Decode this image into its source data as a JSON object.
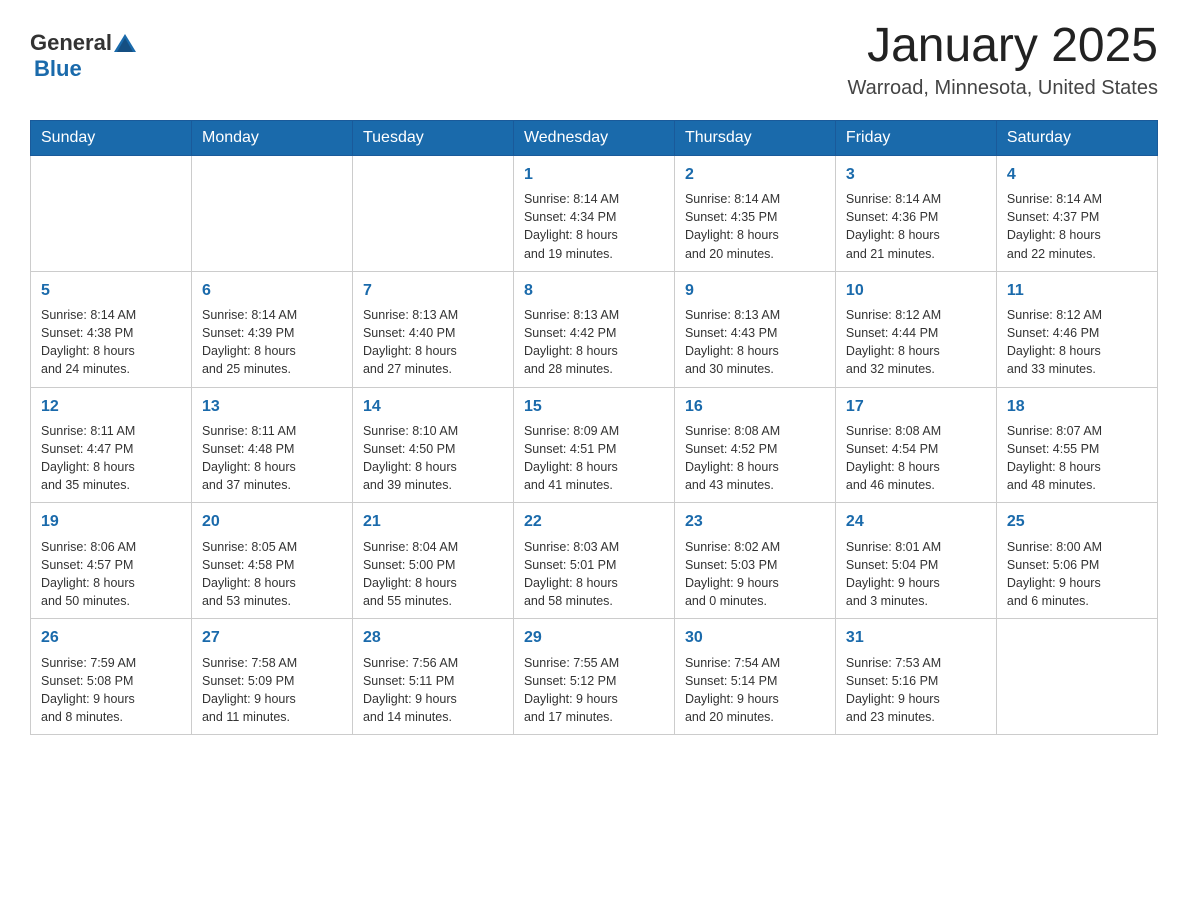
{
  "header": {
    "logo_general": "General",
    "logo_blue": "Blue",
    "month_title": "January 2025",
    "location": "Warroad, Minnesota, United States"
  },
  "days_of_week": [
    "Sunday",
    "Monday",
    "Tuesday",
    "Wednesday",
    "Thursday",
    "Friday",
    "Saturday"
  ],
  "weeks": [
    [
      {
        "day": "",
        "info": ""
      },
      {
        "day": "",
        "info": ""
      },
      {
        "day": "",
        "info": ""
      },
      {
        "day": "1",
        "info": "Sunrise: 8:14 AM\nSunset: 4:34 PM\nDaylight: 8 hours\nand 19 minutes."
      },
      {
        "day": "2",
        "info": "Sunrise: 8:14 AM\nSunset: 4:35 PM\nDaylight: 8 hours\nand 20 minutes."
      },
      {
        "day": "3",
        "info": "Sunrise: 8:14 AM\nSunset: 4:36 PM\nDaylight: 8 hours\nand 21 minutes."
      },
      {
        "day": "4",
        "info": "Sunrise: 8:14 AM\nSunset: 4:37 PM\nDaylight: 8 hours\nand 22 minutes."
      }
    ],
    [
      {
        "day": "5",
        "info": "Sunrise: 8:14 AM\nSunset: 4:38 PM\nDaylight: 8 hours\nand 24 minutes."
      },
      {
        "day": "6",
        "info": "Sunrise: 8:14 AM\nSunset: 4:39 PM\nDaylight: 8 hours\nand 25 minutes."
      },
      {
        "day": "7",
        "info": "Sunrise: 8:13 AM\nSunset: 4:40 PM\nDaylight: 8 hours\nand 27 minutes."
      },
      {
        "day": "8",
        "info": "Sunrise: 8:13 AM\nSunset: 4:42 PM\nDaylight: 8 hours\nand 28 minutes."
      },
      {
        "day": "9",
        "info": "Sunrise: 8:13 AM\nSunset: 4:43 PM\nDaylight: 8 hours\nand 30 minutes."
      },
      {
        "day": "10",
        "info": "Sunrise: 8:12 AM\nSunset: 4:44 PM\nDaylight: 8 hours\nand 32 minutes."
      },
      {
        "day": "11",
        "info": "Sunrise: 8:12 AM\nSunset: 4:46 PM\nDaylight: 8 hours\nand 33 minutes."
      }
    ],
    [
      {
        "day": "12",
        "info": "Sunrise: 8:11 AM\nSunset: 4:47 PM\nDaylight: 8 hours\nand 35 minutes."
      },
      {
        "day": "13",
        "info": "Sunrise: 8:11 AM\nSunset: 4:48 PM\nDaylight: 8 hours\nand 37 minutes."
      },
      {
        "day": "14",
        "info": "Sunrise: 8:10 AM\nSunset: 4:50 PM\nDaylight: 8 hours\nand 39 minutes."
      },
      {
        "day": "15",
        "info": "Sunrise: 8:09 AM\nSunset: 4:51 PM\nDaylight: 8 hours\nand 41 minutes."
      },
      {
        "day": "16",
        "info": "Sunrise: 8:08 AM\nSunset: 4:52 PM\nDaylight: 8 hours\nand 43 minutes."
      },
      {
        "day": "17",
        "info": "Sunrise: 8:08 AM\nSunset: 4:54 PM\nDaylight: 8 hours\nand 46 minutes."
      },
      {
        "day": "18",
        "info": "Sunrise: 8:07 AM\nSunset: 4:55 PM\nDaylight: 8 hours\nand 48 minutes."
      }
    ],
    [
      {
        "day": "19",
        "info": "Sunrise: 8:06 AM\nSunset: 4:57 PM\nDaylight: 8 hours\nand 50 minutes."
      },
      {
        "day": "20",
        "info": "Sunrise: 8:05 AM\nSunset: 4:58 PM\nDaylight: 8 hours\nand 53 minutes."
      },
      {
        "day": "21",
        "info": "Sunrise: 8:04 AM\nSunset: 5:00 PM\nDaylight: 8 hours\nand 55 minutes."
      },
      {
        "day": "22",
        "info": "Sunrise: 8:03 AM\nSunset: 5:01 PM\nDaylight: 8 hours\nand 58 minutes."
      },
      {
        "day": "23",
        "info": "Sunrise: 8:02 AM\nSunset: 5:03 PM\nDaylight: 9 hours\nand 0 minutes."
      },
      {
        "day": "24",
        "info": "Sunrise: 8:01 AM\nSunset: 5:04 PM\nDaylight: 9 hours\nand 3 minutes."
      },
      {
        "day": "25",
        "info": "Sunrise: 8:00 AM\nSunset: 5:06 PM\nDaylight: 9 hours\nand 6 minutes."
      }
    ],
    [
      {
        "day": "26",
        "info": "Sunrise: 7:59 AM\nSunset: 5:08 PM\nDaylight: 9 hours\nand 8 minutes."
      },
      {
        "day": "27",
        "info": "Sunrise: 7:58 AM\nSunset: 5:09 PM\nDaylight: 9 hours\nand 11 minutes."
      },
      {
        "day": "28",
        "info": "Sunrise: 7:56 AM\nSunset: 5:11 PM\nDaylight: 9 hours\nand 14 minutes."
      },
      {
        "day": "29",
        "info": "Sunrise: 7:55 AM\nSunset: 5:12 PM\nDaylight: 9 hours\nand 17 minutes."
      },
      {
        "day": "30",
        "info": "Sunrise: 7:54 AM\nSunset: 5:14 PM\nDaylight: 9 hours\nand 20 minutes."
      },
      {
        "day": "31",
        "info": "Sunrise: 7:53 AM\nSunset: 5:16 PM\nDaylight: 9 hours\nand 23 minutes."
      },
      {
        "day": "",
        "info": ""
      }
    ]
  ]
}
